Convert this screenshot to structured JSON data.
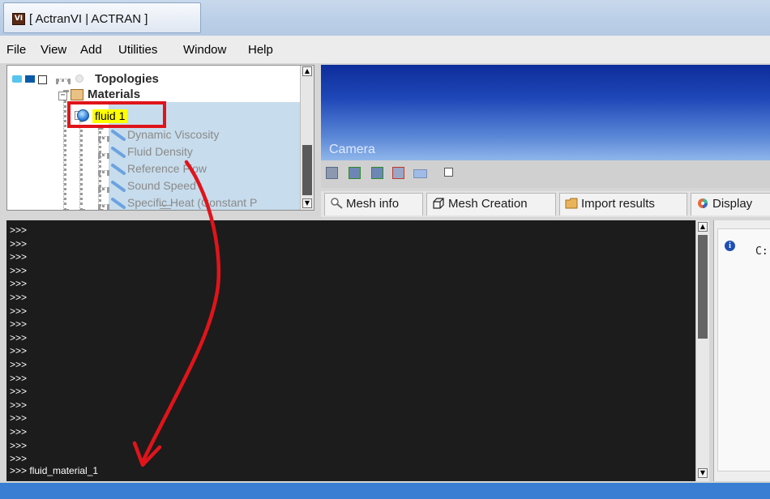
{
  "window": {
    "title": "[  ActranVI |  ACTRAN  ]",
    "app_icon": "VI"
  },
  "menu": [
    "File",
    "View",
    "Add",
    "Utilities",
    "Window",
    "Help"
  ],
  "tree": {
    "topologies": "Topologies",
    "materials": "Materials",
    "fluid": "fluid 1",
    "properties": [
      "Dynamic Viscosity",
      "Fluid Density",
      "Reference Flow",
      "Sound Speed",
      "Specific Heat (Constant P"
    ]
  },
  "viewport": {
    "camera_label": "Camera"
  },
  "tabs": [
    "Mesh info",
    "Mesh Creation",
    "Import results",
    "Display"
  ],
  "console": {
    "prompt": ">>>",
    "empty_prompt_count": 18,
    "last_line": ">>> fluid_material_1"
  },
  "info": {
    "text": "C:"
  },
  "annotation": {
    "color": "#e0141a"
  }
}
